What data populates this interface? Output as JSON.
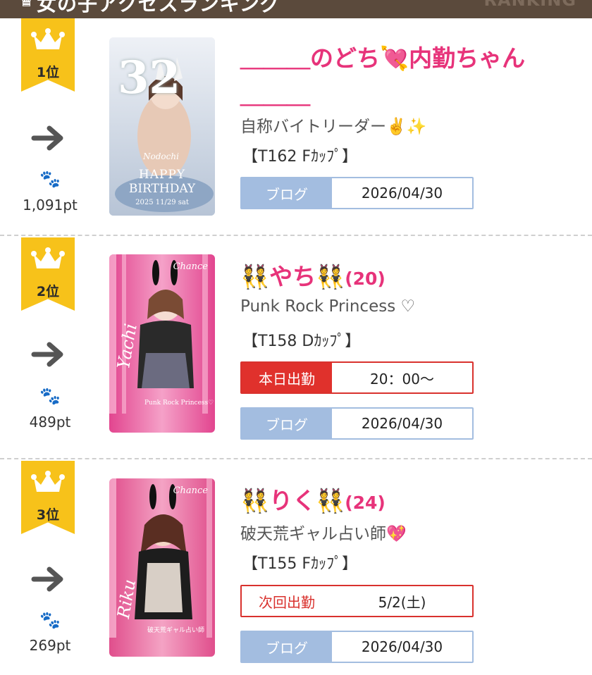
{
  "header": {
    "title": "女の子アクセスランキング",
    "title_en": "RANKING"
  },
  "entries": [
    {
      "rank_label": "1位",
      "trend": "→",
      "points": "1,091pt",
      "name": "＿＿＿のどち💘内勤ちゃん＿＿＿",
      "name_line1": "＿＿＿のどち💘内勤ちゃん",
      "name_line2": "＿＿＿",
      "desc": "自称バイトリーダー✌️✨",
      "size": "【T162 Fｶｯﾌﾟ】",
      "photo_text": {
        "big": "32",
        "sub1": "HAPPY",
        "sub2": "BIRTHDAY",
        "date": "2025 11/29 sat",
        "sign": "Nodochi"
      },
      "rows": [
        {
          "type": "blog",
          "label": "ブログ",
          "value": "2026/04/30"
        }
      ]
    },
    {
      "rank_label": "2位",
      "trend": "→",
      "points": "489pt",
      "name": "👯やち👯",
      "age": "(20)",
      "desc": "Punk Rock Princess ♡",
      "size": "【T158 Dｶｯﾌﾟ】",
      "photo_text": {
        "brand": "Chance",
        "sign": "Yachi",
        "caption": "Punk Rock Princess♡"
      },
      "rows": [
        {
          "type": "today",
          "label": "本日出勤",
          "value": "20：00〜"
        },
        {
          "type": "blog",
          "label": "ブログ",
          "value": "2026/04/30"
        }
      ]
    },
    {
      "rank_label": "3位",
      "trend": "→",
      "points": "269pt",
      "name": "👯りく👯",
      "age": "(24)",
      "desc": "破天荒ギャル占い師💖",
      "size": "【T155 Fｶｯﾌﾟ】",
      "photo_text": {
        "brand": "Chance",
        "sign": "Riku",
        "caption": "破天荒ギャル占い師"
      },
      "rows": [
        {
          "type": "next",
          "label": "次回出勤",
          "value": "5/2(土)"
        },
        {
          "type": "blog",
          "label": "ブログ",
          "value": "2026/04/30"
        }
      ]
    }
  ],
  "colors": {
    "badge": "#f7c21a",
    "name": "#e7337a",
    "blog": "#a3bde0",
    "red": "#e0312c",
    "header": "#5b4a3c"
  },
  "icons": {
    "crown": "crown-icon",
    "arrow": "arrow-right-icon",
    "paw": "paw-icon"
  }
}
